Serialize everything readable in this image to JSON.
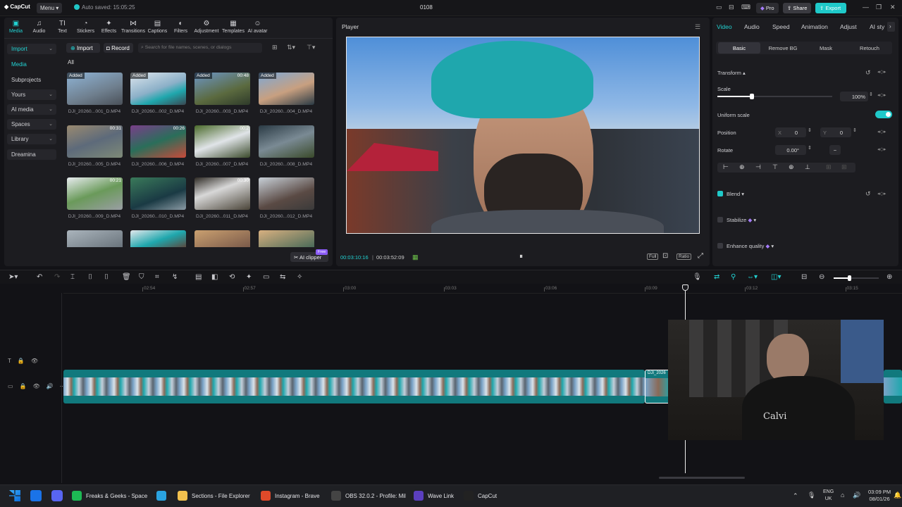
{
  "topbar": {
    "logo": "CapCut",
    "menu": "Menu",
    "autosave": "Auto saved: 15:05:25",
    "project": "0108",
    "pro": "Pro",
    "share": "Share",
    "export": "Export"
  },
  "media_tools": [
    {
      "label": "Media",
      "icon": "media-icon"
    },
    {
      "label": "Audio",
      "icon": "audio-icon"
    },
    {
      "label": "Text",
      "icon": "text-icon"
    },
    {
      "label": "Stickers",
      "icon": "sticker-icon"
    },
    {
      "label": "Effects",
      "icon": "effects-icon"
    },
    {
      "label": "Transitions",
      "icon": "transitions-icon"
    },
    {
      "label": "Captions",
      "icon": "captions-icon"
    },
    {
      "label": "Filters",
      "icon": "filters-icon"
    },
    {
      "label": "Adjustment",
      "icon": "adjustment-icon"
    },
    {
      "label": "Templates",
      "icon": "templates-icon"
    },
    {
      "label": "AI avatar",
      "icon": "avatar-icon"
    }
  ],
  "sidebar": {
    "items": [
      "Import",
      "Media",
      "Subprojects",
      "Yours",
      "AI media",
      "Spaces",
      "Library",
      "Dreamina"
    ]
  },
  "media": {
    "import_btn": "Import",
    "record_btn": "Record",
    "search_placeholder": "Search for file names, scenes, or dialogs",
    "filter_all": "All",
    "ai_clipper": "AI clipper",
    "free_badge": "Free",
    "added": "Added",
    "items": [
      {
        "name": "DJI_20260...001_D.MP4",
        "added": true,
        "dur": ""
      },
      {
        "name": "DJI_20260...002_D.MP4",
        "added": true,
        "dur": ""
      },
      {
        "name": "DJI_20260...003_D.MP4",
        "added": true,
        "dur": "00:48"
      },
      {
        "name": "DJI_20260...004_D.MP4",
        "added": true,
        "dur": ""
      },
      {
        "name": "DJI_20260...005_D.MP4",
        "added": false,
        "dur": "00:31"
      },
      {
        "name": "DJI_20260...006_D.MP4",
        "added": false,
        "dur": "00:26"
      },
      {
        "name": "DJI_20260...007_D.MP4",
        "added": false,
        "dur": "00:2"
      },
      {
        "name": "DJI_20260...008_D.MP4",
        "added": false,
        "dur": ""
      },
      {
        "name": "DJI_20260...009_D.MP4",
        "added": false,
        "dur": "00:21"
      },
      {
        "name": "DJI_20260...010_D.MP4",
        "added": false,
        "dur": ""
      },
      {
        "name": "DJI_20260...011_D.MP4",
        "added": false,
        "dur": "00:30"
      },
      {
        "name": "DJI_20260...012_D.MP4",
        "added": false,
        "dur": ""
      }
    ]
  },
  "player": {
    "title": "Player",
    "current": "00:03:10:16",
    "total": "00:03:52:09",
    "full": "Full",
    "ratio": "Ratio"
  },
  "props": {
    "tabs": [
      "Video",
      "Audio",
      "Speed",
      "Animation",
      "Adjust",
      "AI sty"
    ],
    "subtabs": [
      "Basic",
      "Remove BG",
      "Mask",
      "Retouch"
    ],
    "transform": "Transform",
    "scale_label": "Scale",
    "scale_value": "100%",
    "scale_level": 0.3,
    "uniform_scale": "Uniform scale",
    "position_label": "Position",
    "pos_x_label": "X",
    "pos_x": "0",
    "pos_y_label": "Y",
    "pos_y": "0",
    "rotate_label": "Rotate",
    "rotate_value": "0.00°",
    "blend": "Blend",
    "stabilize": "Stabilize",
    "enhance": "Enhance quality"
  },
  "timeline": {
    "ruler": [
      "02:54",
      "02:57",
      "03:00",
      "03:03",
      "03:06",
      "03:09",
      "03:12",
      "03:15"
    ],
    "clip_label": "DJI_2026",
    "zoom_level": 0.35
  },
  "taskbar": {
    "apps": [
      {
        "label": "Freaks & Geeks - Space",
        "color": "#1db954"
      },
      {
        "label": "",
        "color": "#2aa3e0"
      },
      {
        "label": "Sections - File Explorer",
        "color": "#f2c14e"
      },
      {
        "label": "Instagram - Brave",
        "color": "#e04a2a"
      },
      {
        "label": "OBS 32.0.2 - Profile: Mil",
        "color": "#444"
      },
      {
        "label": "Wave Link",
        "color": "#5b3fbf"
      },
      {
        "label": "CapCut",
        "color": "#222"
      }
    ],
    "lang1": "ENG",
    "lang2": "UK",
    "time": "03:09 PM",
    "date": "08/01/26"
  }
}
